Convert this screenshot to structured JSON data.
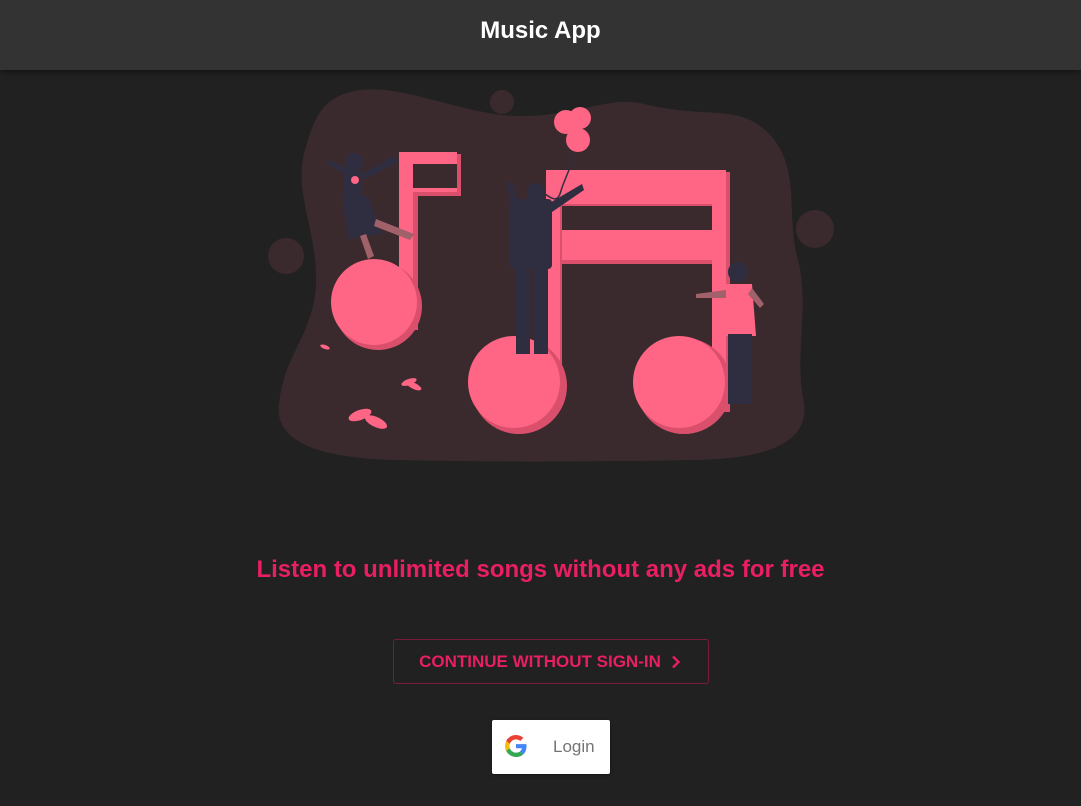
{
  "app_bar": {
    "title": "Music App"
  },
  "hero": {
    "illustration": "music-notes-people-illustration",
    "tagline": "Listen to unlimited songs without any ads for free"
  },
  "actions": {
    "continue_label": "CONTINUE WITHOUT SIGN-IN",
    "continue_icon": "chevron-right-icon",
    "google_login_label": "Login",
    "google_icon": "google-logo-icon"
  },
  "colors": {
    "background": "#212121",
    "app_bar": "#333333",
    "accent": "#e91e63",
    "illustration_pink": "#ff6584",
    "blob": "#3a2a2e"
  }
}
